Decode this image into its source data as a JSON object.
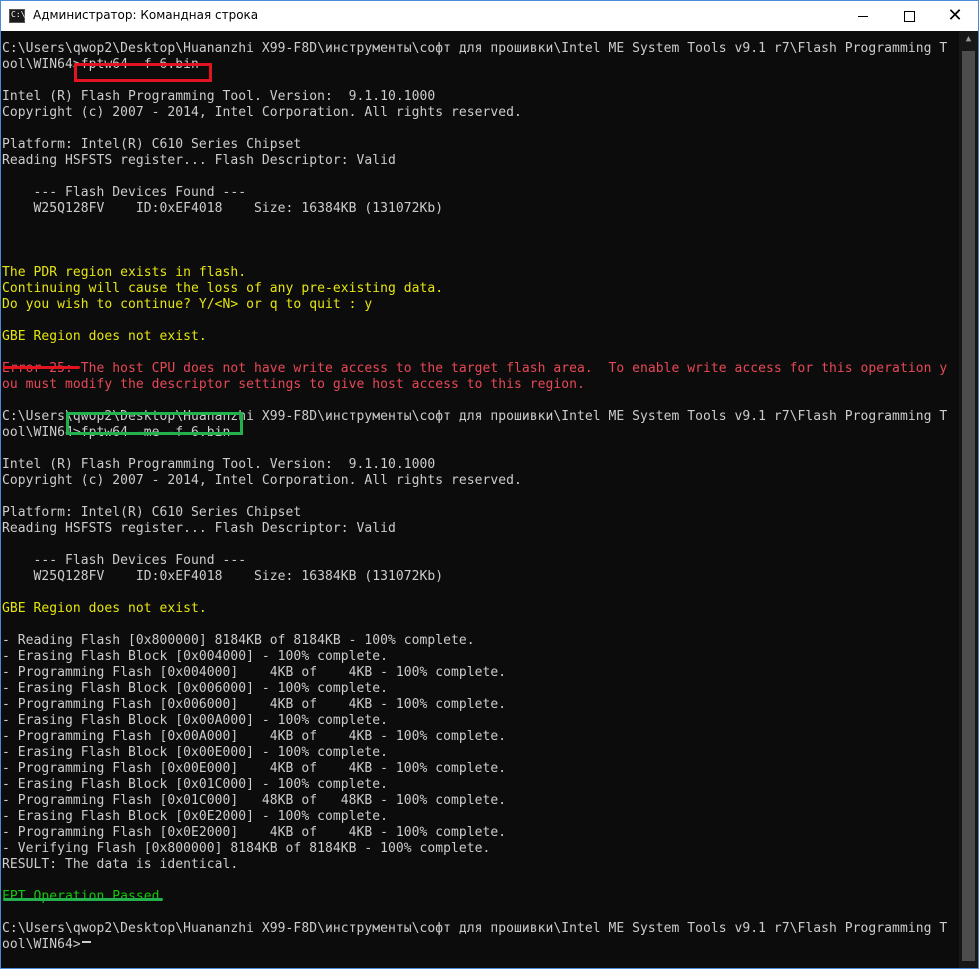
{
  "window": {
    "title": "Администратор: Командная строка",
    "buttons": {
      "minimize": "minimize",
      "maximize": "maximize",
      "close": "close"
    }
  },
  "console": {
    "lines": [
      {
        "text": "C:\\Users\\qwop2\\Desktop\\Huananzhi X99-F8D\\инструменты\\софт для прошивки\\Intel ME System Tools v9.1 r7\\Flash Programming T",
        "color": "gray"
      },
      {
        "text": "ool\\WIN64>fptw64 -f 6.bin",
        "color": "gray"
      },
      {
        "text": "",
        "color": "gray"
      },
      {
        "text": "Intel (R) Flash Programming Tool. Version:  9.1.10.1000",
        "color": "gray"
      },
      {
        "text": "Copyright (c) 2007 - 2014, Intel Corporation. All rights reserved.",
        "color": "gray"
      },
      {
        "text": "",
        "color": "gray"
      },
      {
        "text": "Platform: Intel(R) C610 Series Chipset",
        "color": "gray"
      },
      {
        "text": "Reading HSFSTS register... Flash Descriptor: Valid",
        "color": "gray"
      },
      {
        "text": "",
        "color": "gray"
      },
      {
        "text": "    --- Flash Devices Found ---",
        "color": "gray"
      },
      {
        "text": "    W25Q128FV    ID:0xEF4018    Size: 16384KB (131072Kb)",
        "color": "gray"
      },
      {
        "text": "",
        "color": "gray"
      },
      {
        "text": "",
        "color": "gray"
      },
      {
        "text": "",
        "color": "gray"
      },
      {
        "text": "The PDR region exists in flash.",
        "color": "yellow"
      },
      {
        "text": "Continuing will cause the loss of any pre-existing data.",
        "color": "yellow"
      },
      {
        "text": "Do you wish to continue? Y/<N> or q to quit : y",
        "color": "yellow"
      },
      {
        "text": "",
        "color": "gray"
      },
      {
        "text": "GBE Region does not exist.",
        "color": "yellow"
      },
      {
        "text": "",
        "color": "gray"
      },
      {
        "text": "Error 25: The host CPU does not have write access to the target flash area.  To enable write access for this operation y",
        "color": "red"
      },
      {
        "text": "ou must modify the descriptor settings to give host access to this region.",
        "color": "red"
      },
      {
        "text": "",
        "color": "gray"
      },
      {
        "text": "C:\\Users\\qwop2\\Desktop\\Huananzhi X99-F8D\\инструменты\\софт для прошивки\\Intel ME System Tools v9.1 r7\\Flash Programming T",
        "color": "gray"
      },
      {
        "text": "ool\\WIN64>fptw64 -me -f 6.bin",
        "color": "gray"
      },
      {
        "text": "",
        "color": "gray"
      },
      {
        "text": "Intel (R) Flash Programming Tool. Version:  9.1.10.1000",
        "color": "gray"
      },
      {
        "text": "Copyright (c) 2007 - 2014, Intel Corporation. All rights reserved.",
        "color": "gray"
      },
      {
        "text": "",
        "color": "gray"
      },
      {
        "text": "Platform: Intel(R) C610 Series Chipset",
        "color": "gray"
      },
      {
        "text": "Reading HSFSTS register... Flash Descriptor: Valid",
        "color": "gray"
      },
      {
        "text": "",
        "color": "gray"
      },
      {
        "text": "    --- Flash Devices Found ---",
        "color": "gray"
      },
      {
        "text": "    W25Q128FV    ID:0xEF4018    Size: 16384KB (131072Kb)",
        "color": "gray"
      },
      {
        "text": "",
        "color": "gray"
      },
      {
        "text": "GBE Region does not exist.",
        "color": "yellow"
      },
      {
        "text": "",
        "color": "gray"
      },
      {
        "text": "- Reading Flash [0x800000] 8184KB of 8184KB - 100% complete.",
        "color": "gray"
      },
      {
        "text": "- Erasing Flash Block [0x004000] - 100% complete.",
        "color": "gray"
      },
      {
        "text": "- Programming Flash [0x004000]    4KB of    4KB - 100% complete.",
        "color": "gray"
      },
      {
        "text": "- Erasing Flash Block [0x006000] - 100% complete.",
        "color": "gray"
      },
      {
        "text": "- Programming Flash [0x006000]    4KB of    4KB - 100% complete.",
        "color": "gray"
      },
      {
        "text": "- Erasing Flash Block [0x00A000] - 100% complete.",
        "color": "gray"
      },
      {
        "text": "- Programming Flash [0x00A000]    4KB of    4KB - 100% complete.",
        "color": "gray"
      },
      {
        "text": "- Erasing Flash Block [0x00E000] - 100% complete.",
        "color": "gray"
      },
      {
        "text": "- Programming Flash [0x00E000]    4KB of    4KB - 100% complete.",
        "color": "gray"
      },
      {
        "text": "- Erasing Flash Block [0x01C000] - 100% complete.",
        "color": "gray"
      },
      {
        "text": "- Programming Flash [0x01C000]   48KB of   48KB - 100% complete.",
        "color": "gray"
      },
      {
        "text": "- Erasing Flash Block [0x0E2000] - 100% complete.",
        "color": "gray"
      },
      {
        "text": "- Programming Flash [0x0E2000]    4KB of    4KB - 100% complete.",
        "color": "gray"
      },
      {
        "text": "- Verifying Flash [0x800000] 8184KB of 8184KB - 100% complete.",
        "color": "gray"
      },
      {
        "text": "RESULT: The data is identical.",
        "color": "gray"
      },
      {
        "text": "",
        "color": "gray"
      },
      {
        "text": "FPT Operation Passed",
        "color": "green"
      },
      {
        "text": "",
        "color": "gray"
      },
      {
        "text": "C:\\Users\\qwop2\\Desktop\\Huananzhi X99-F8D\\инструменты\\софт для прошивки\\Intel ME System Tools v9.1 r7\\Flash Programming T",
        "color": "gray"
      },
      {
        "text": "ool\\WIN64>",
        "color": "gray"
      }
    ]
  },
  "annotations": {
    "red_box_color": "#e3131f",
    "green_box_color": "#22b14c"
  },
  "colors": {
    "console_bg": "#0c0c0c",
    "text_gray": "#cccccc",
    "text_yellow": "#e5e510",
    "text_red": "#e74856",
    "text_green": "#16c60c"
  }
}
